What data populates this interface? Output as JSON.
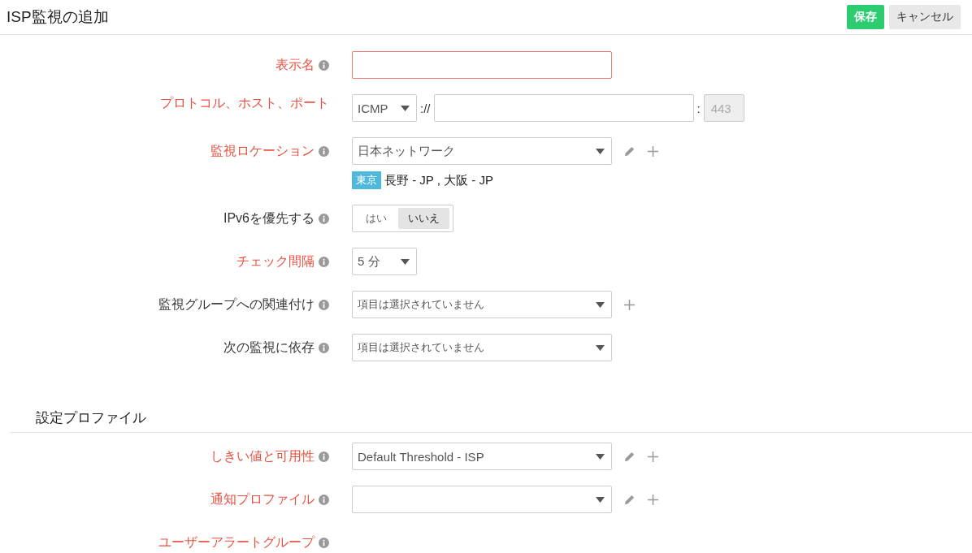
{
  "header": {
    "title": "ISP監視の追加",
    "buttons": [
      {
        "label": "保存",
        "kind": "primary"
      },
      {
        "label": "キャンセル",
        "kind": "secondary"
      }
    ]
  },
  "fields": [
    {
      "label": "表示名",
      "required": true,
      "info": true,
      "kind": "text",
      "invalid": true
    },
    {
      "label": "プロトコル、ホスト、ポート",
      "required": true,
      "kind": "protocol",
      "protocol": "ICMP",
      "separator": "://",
      "colon": ":",
      "port": {
        "placeholder": "443",
        "disabled": true
      }
    },
    {
      "label": "監視ロケーション",
      "required": true,
      "info": true,
      "kind": "select",
      "value": "日本ネットワーク",
      "editable": true,
      "addable": true,
      "tag": "東京",
      "locations": "長野 - JP , 大阪 - JP"
    },
    {
      "label": "IPv6を優先する",
      "required": false,
      "info": true,
      "kind": "toggle",
      "options": [
        {
          "label": "はい",
          "selected": false
        },
        {
          "label": "いいえ",
          "selected": true
        }
      ]
    },
    {
      "label": "チェック間隔",
      "required": true,
      "info": true,
      "kind": "small-select",
      "value": "5 分"
    },
    {
      "label": "監視グループへの関連付け",
      "required": false,
      "info": true,
      "kind": "select",
      "placeholder": "項目は選択されていません",
      "addable": true
    },
    {
      "label": "次の監視に依存",
      "required": false,
      "info": true,
      "kind": "select",
      "placeholder": "項目は選択されていません"
    }
  ],
  "profile_section": {
    "title": "設定プロファイル",
    "fields": [
      {
        "label": "しきい値と可用性",
        "required": true,
        "info": true,
        "kind": "select",
        "value": "Default Threshold - ISP",
        "editable": true,
        "addable": true
      },
      {
        "label": "通知プロファイル",
        "required": true,
        "info": true,
        "kind": "select",
        "editable": true,
        "addable": true
      },
      {
        "label": "ユーザーアラートグループ",
        "required": true,
        "info": true,
        "kind": "label"
      }
    ]
  }
}
